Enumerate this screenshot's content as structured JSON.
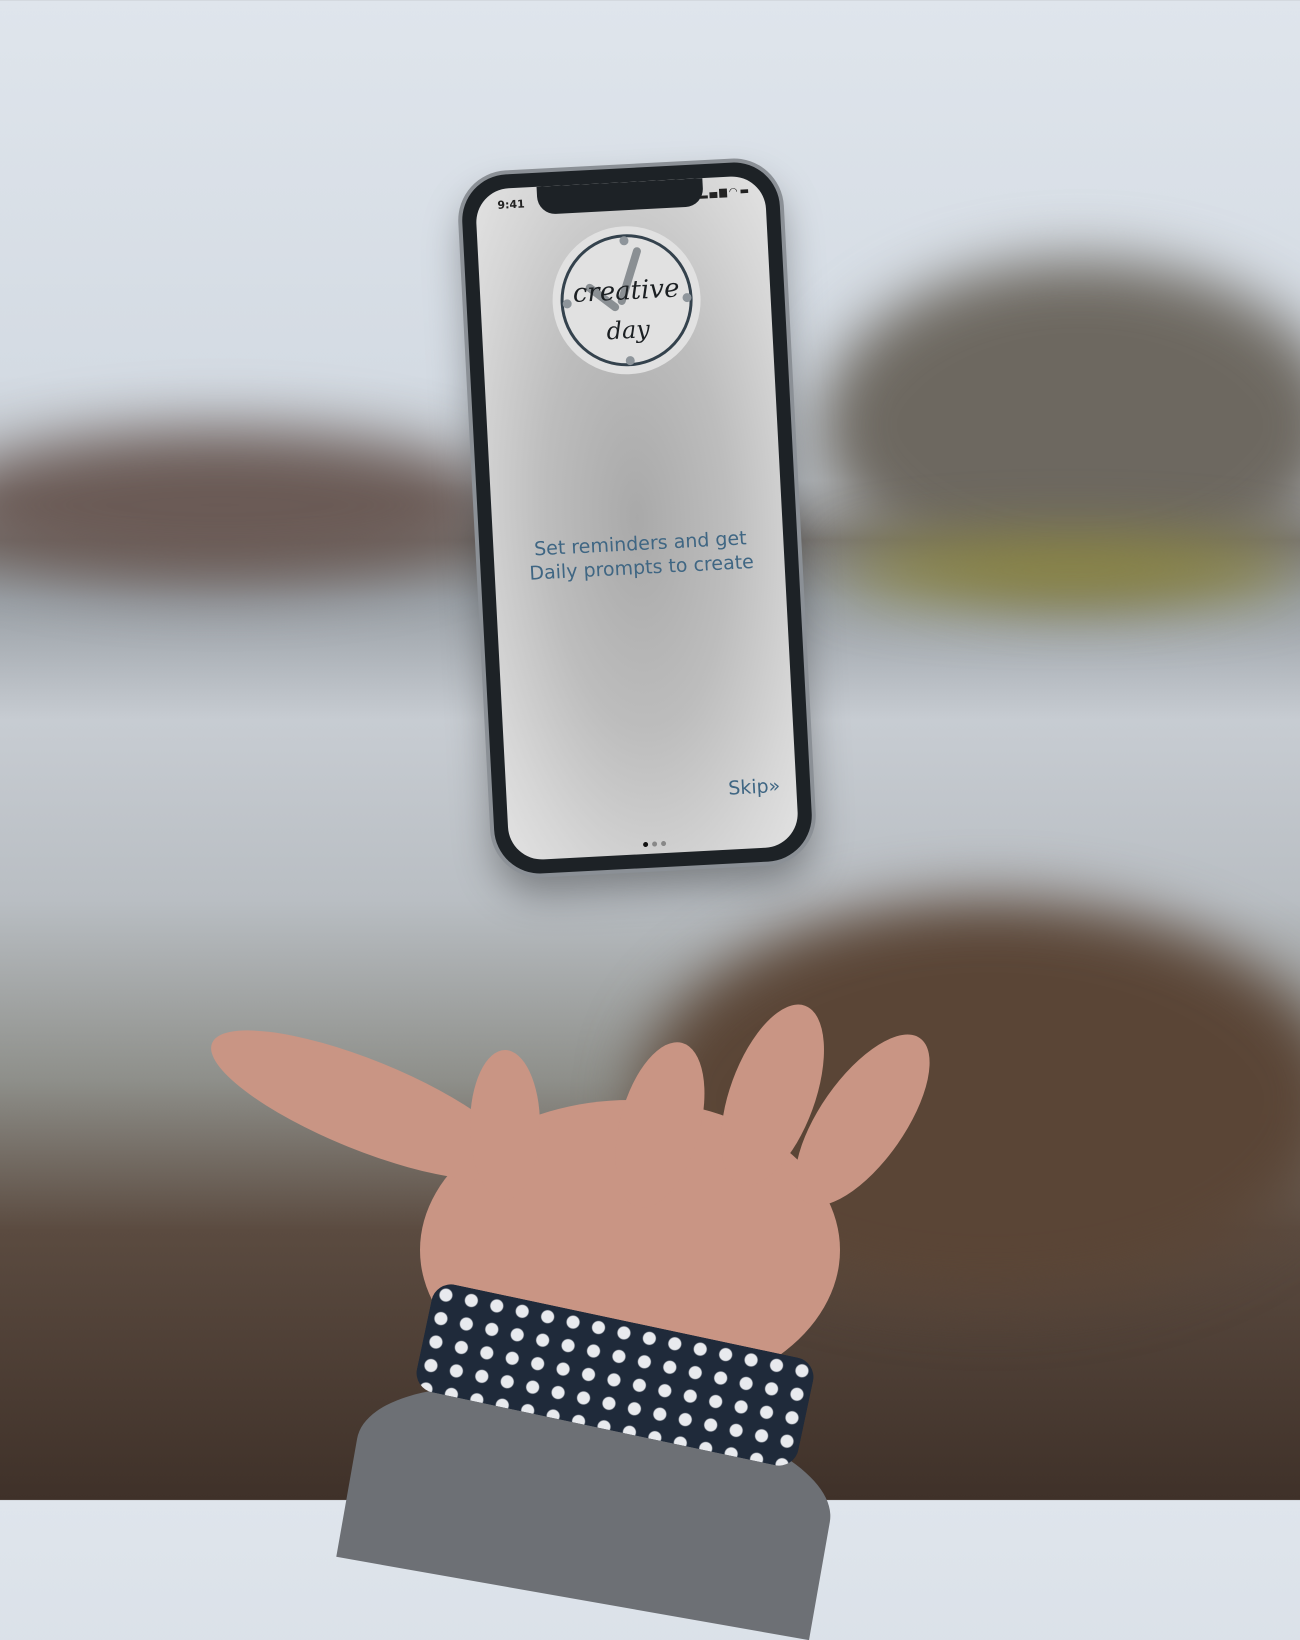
{
  "status_bar": {
    "time": "9:41",
    "icons": [
      "signal-icon",
      "wifi-icon",
      "battery-icon"
    ]
  },
  "logo": {
    "line1": "creative",
    "line2": "day"
  },
  "onboarding": {
    "message": "Set reminders and get Daily prompts to create",
    "skip_label": "Skip",
    "skip_icon": "»",
    "page_count": 3,
    "current_page": 1
  },
  "colors": {
    "accent": "#3f6683",
    "logo_ring": "#34424d"
  }
}
